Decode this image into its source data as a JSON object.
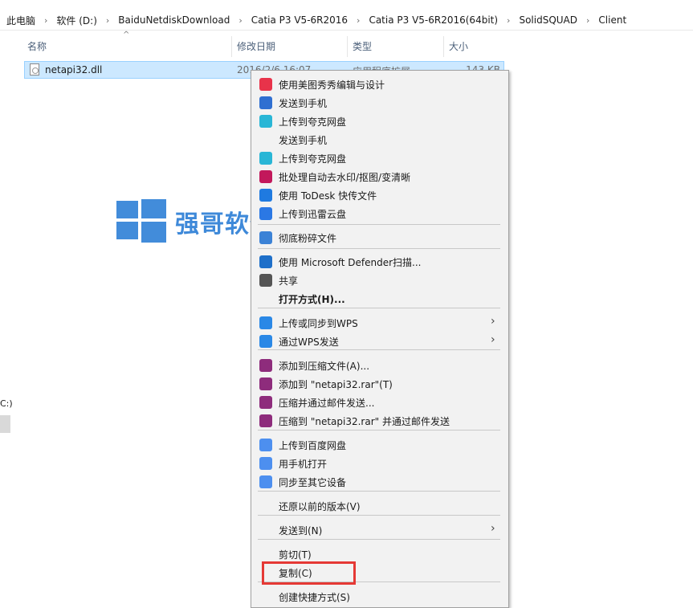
{
  "breadcrumb": [
    "此电脑",
    "软件 (D:)",
    "BaiduNetdiskDownload",
    "Catia P3 V5-6R2016",
    "Catia P3 V5-6R2016(64bit)",
    "SolidSQUAD",
    "Client"
  ],
  "columns": {
    "name": "名称",
    "date": "修改日期",
    "type": "类型",
    "size": "大小"
  },
  "file": {
    "name": "netapi32.dll",
    "date": "2016/2/6 16:07",
    "type": "应用程序扩展",
    "size": "143 KB"
  },
  "left_fragment": "C:)",
  "watermark": {
    "text": "强哥软件管家"
  },
  "menu": {
    "items": [
      {
        "label": "使用美图秀秀编辑与设计",
        "icon": "meitu-icon",
        "color": "#e8334a"
      },
      {
        "label": "发送到手机",
        "icon": "phone-send-icon",
        "color": "#2f6fd1"
      },
      {
        "label": "上传到夸克网盘",
        "icon": "quark-cloud-icon",
        "color": "#29b6d6"
      },
      {
        "label": "发送到手机",
        "icon": "",
        "color": ""
      },
      {
        "label": "上传到夸克网盘",
        "icon": "quark-cloud-icon",
        "color": "#29b6d6"
      },
      {
        "label": "批处理自动去水印/抠图/变清晰",
        "icon": "batch-edit-icon",
        "color": "#c2185b"
      },
      {
        "label": "使用 ToDesk 快传文件",
        "icon": "todesk-icon",
        "color": "#1f7ae0"
      },
      {
        "label": "上传到迅雷云盘",
        "icon": "xunlei-icon",
        "color": "#2b78e4"
      },
      {
        "label": "彻底粉碎文件",
        "icon": "shredder-icon",
        "color": "#3b82d6"
      },
      {
        "label": "使用 Microsoft Defender扫描...",
        "icon": "defender-shield-icon",
        "color": "#1e6fc9"
      },
      {
        "label": "共享",
        "icon": "share-icon",
        "color": "#555555"
      },
      {
        "label": "打开方式(H)...",
        "icon": "",
        "color": ""
      },
      {
        "label": "上传或同步到WPS",
        "icon": "wps-cloud-icon",
        "color": "#2a88e6"
      },
      {
        "label": "通过WPS发送",
        "icon": "wps-send-icon",
        "color": "#2a88e6"
      },
      {
        "label": "添加到压缩文件(A)...",
        "icon": "winrar-icon",
        "color": "#8e2c7c"
      },
      {
        "label": "添加到 \"netapi32.rar\"(T)",
        "icon": "winrar-icon",
        "color": "#8e2c7c"
      },
      {
        "label": "压缩并通过邮件发送...",
        "icon": "winrar-icon",
        "color": "#8e2c7c"
      },
      {
        "label": "压缩到 \"netapi32.rar\" 并通过邮件发送",
        "icon": "winrar-icon",
        "color": "#8e2c7c"
      },
      {
        "label": "上传到百度网盘",
        "icon": "baidu-netdisk-icon",
        "color": "#4d8fef"
      },
      {
        "label": "用手机打开",
        "icon": "baidu-netdisk-icon",
        "color": "#4d8fef"
      },
      {
        "label": "同步至其它设备",
        "icon": "baidu-netdisk-icon",
        "color": "#4d8fef"
      },
      {
        "label": "还原以前的版本(V)",
        "icon": "",
        "color": ""
      },
      {
        "label": "发送到(N)",
        "icon": "",
        "color": ""
      },
      {
        "label": "剪切(T)",
        "icon": "",
        "color": ""
      },
      {
        "label": "复制(C)",
        "icon": "",
        "color": ""
      },
      {
        "label": "创建快捷方式(S)",
        "icon": "",
        "color": ""
      }
    ]
  },
  "colors": {
    "selection": "#cce8ff",
    "accent": "#2e7fd6",
    "highlight": "#e53935"
  }
}
